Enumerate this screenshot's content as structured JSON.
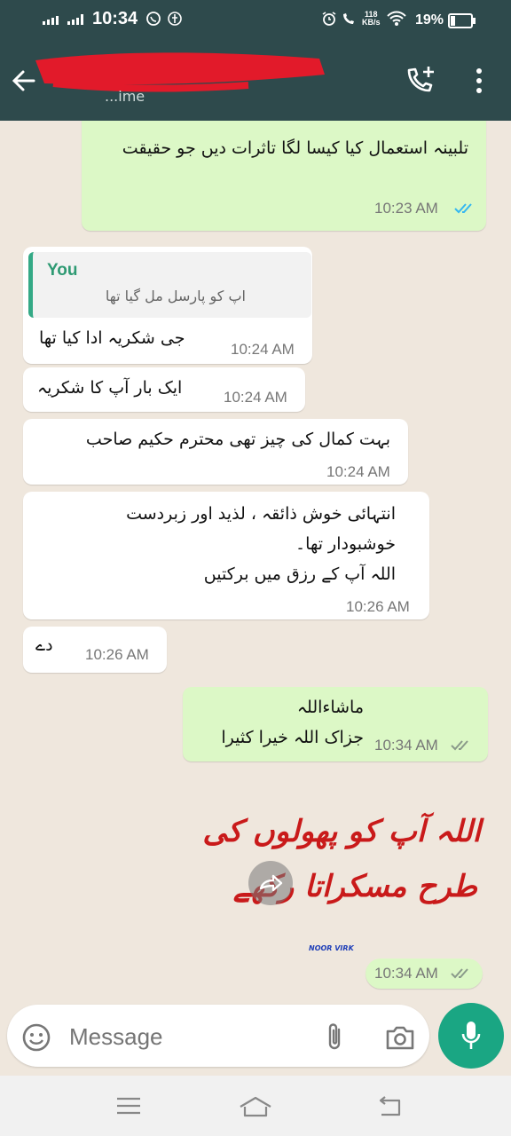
{
  "status_bar": {
    "time": "10:34",
    "battery_percent": "19%",
    "net_speed_value": "118",
    "net_speed_unit": "KB/s"
  },
  "header": {
    "contact_subtitle": "...ime",
    "icons": [
      "back-arrow-icon",
      "add-call-icon",
      "more-options-icon"
    ]
  },
  "messages": [
    {
      "dir": "out",
      "text": "تلبینہ استعمال کیا کیسا لگا تاثرات دیں جو حقیقت",
      "time": "10:23 AM",
      "status": "read"
    },
    {
      "dir": "in",
      "reply_to": {
        "author": "You",
        "text": "اپ کو پارسل مل گیا تھا"
      },
      "text": "جی شکریہ ادا کیا تھا",
      "time": "10:24 AM"
    },
    {
      "dir": "in",
      "text": "ایک بار آپ کا شکریہ",
      "time": "10:24 AM"
    },
    {
      "dir": "in",
      "text": "بہت کمال کی چیز تھی محترم حکیم صاحب",
      "time": "10:24 AM"
    },
    {
      "dir": "in",
      "lines": [
        "انتہائی خوش ذائقہ ، لذید اور زبردست",
        "خوشبودار تھا۔",
        "اللہ آپ کے رزق میں برکتیں"
      ],
      "time": "10:26 AM"
    },
    {
      "dir": "in",
      "text": "دے",
      "time": "10:26 AM"
    },
    {
      "dir": "out",
      "lines": [
        "ماشاءاللہ",
        "جزاک اللہ خیرا کثیرا"
      ],
      "time": "10:34 AM",
      "status": "delivered"
    },
    {
      "dir": "out",
      "sticker": {
        "line1": "اللہ آپ کو پھولوں کی",
        "line2": "طرح مسکراتا رکھے",
        "signature": "NOOR VIRK"
      },
      "time": "10:34 AM",
      "status": "delivered"
    }
  ],
  "composer": {
    "placeholder": "Message"
  },
  "colors": {
    "header": "#2e4a4c",
    "outgoing_bubble": "#dcf8c6",
    "incoming_bubble": "#ffffff",
    "accent": "#1aa683",
    "read_ticks": "#34b7f1"
  }
}
